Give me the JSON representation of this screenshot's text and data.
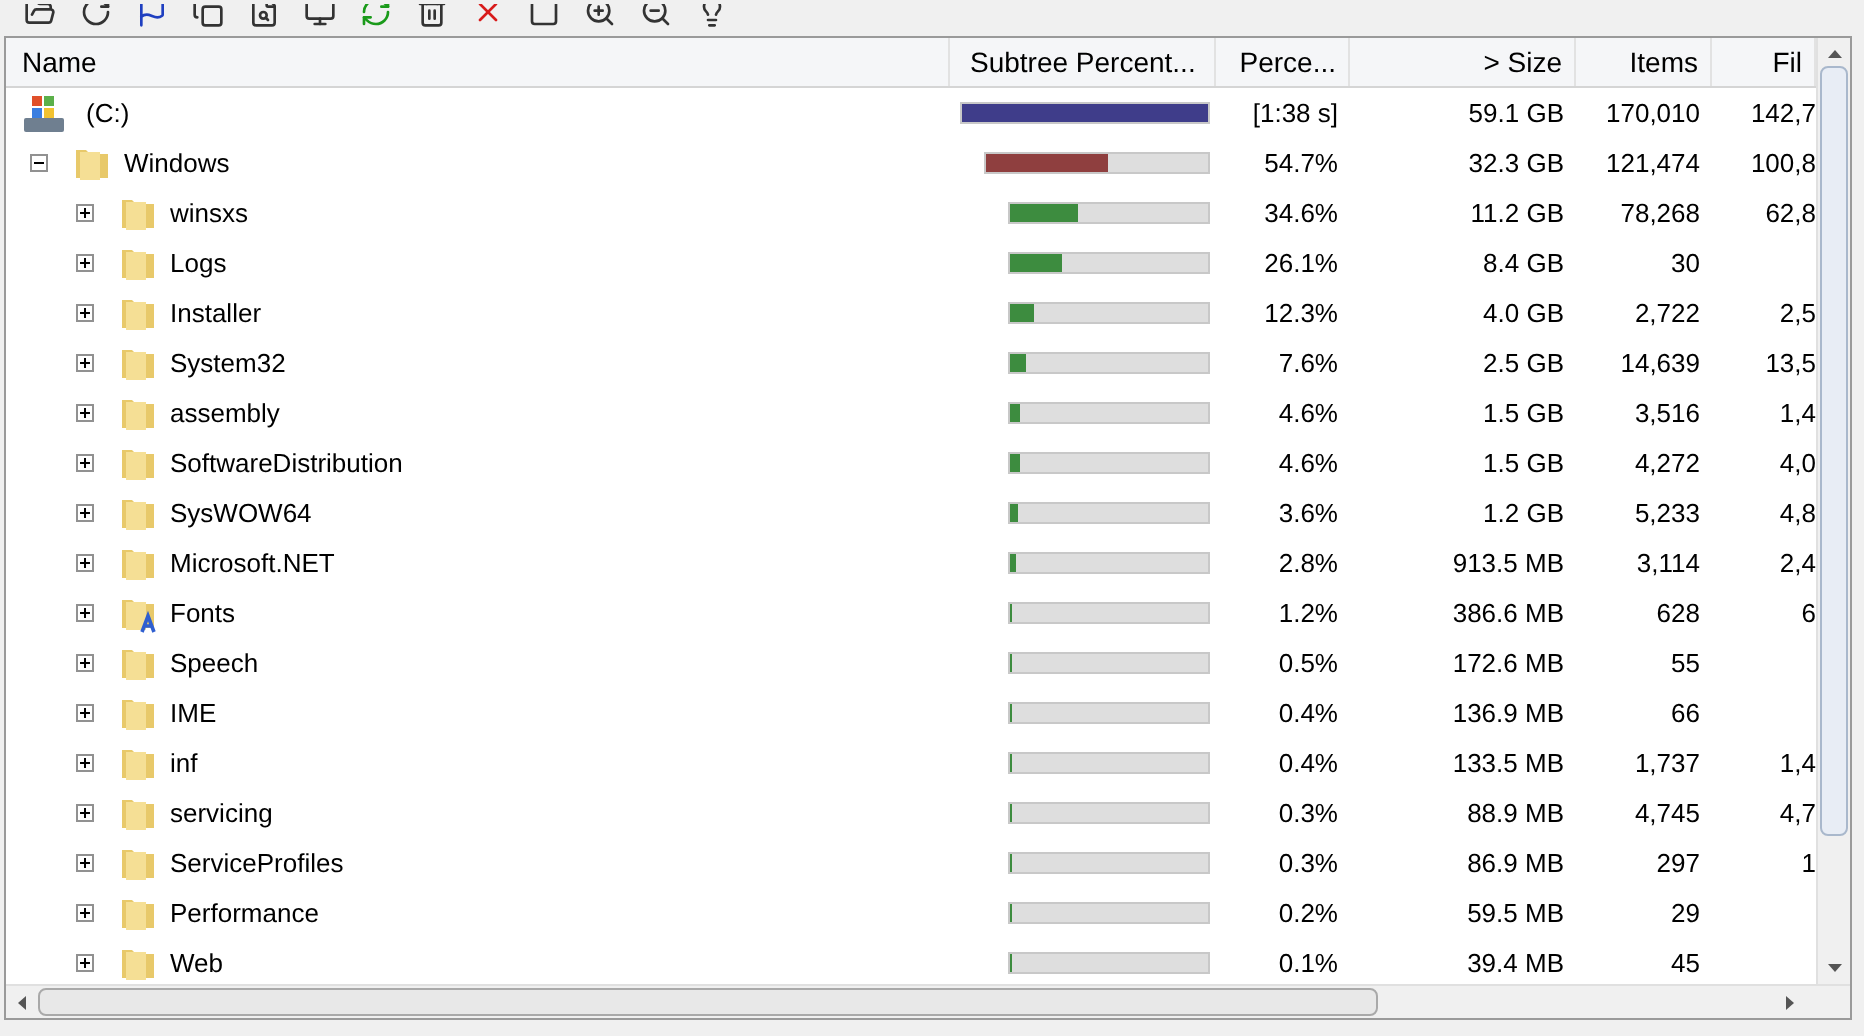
{
  "columns": [
    {
      "label": "Name"
    },
    {
      "label": "Subtree Percent..."
    },
    {
      "label": "Perce..."
    },
    {
      "label": "> Size"
    },
    {
      "label": "Items"
    },
    {
      "label": "Fil"
    }
  ],
  "tree": [
    {
      "name": "(C:)",
      "kind": "drive",
      "level": 1,
      "percent": "[1:38 s]",
      "size": "59.1 GB",
      "items": "170,010",
      "files": "142,7",
      "children": [
        {
          "name": "Windows",
          "kind": "folder",
          "level": 0.547,
          "percent": "54.7%",
          "size": "32.3 GB",
          "items": "121,474",
          "files": "100,8",
          "expanded": true,
          "children": [
            {
              "name": "winsxs",
              "kind": "folder",
              "level": 0.346,
              "percent": "34.6%",
              "size": "11.2 GB",
              "items": "78,268",
              "files": "62,8",
              "expanded": false
            },
            {
              "name": "Logs",
              "kind": "folder",
              "level": 0.261,
              "percent": "26.1%",
              "size": "8.4 GB",
              "items": "30",
              "expanded": false
            },
            {
              "name": "Installer",
              "kind": "folder",
              "level": 0.123,
              "percent": "12.3%",
              "size": "4.0 GB",
              "items": "2,722",
              "files": "2,5",
              "expanded": false
            },
            {
              "name": "System32",
              "kind": "folder",
              "level": 0.076,
              "percent": "7.6%",
              "size": "2.5 GB",
              "items": "14,639",
              "files": "13,5",
              "expanded": false
            },
            {
              "name": "assembly",
              "kind": "folder",
              "level": 0.046,
              "percent": "4.6%",
              "size": "1.5 GB",
              "items": "3,516",
              "files": "1,4",
              "expanded": false
            },
            {
              "name": "SoftwareDistribution",
              "kind": "folder",
              "level": 0.046,
              "percent": "4.6%",
              "size": "1.5 GB",
              "items": "4,272",
              "files": "4,0",
              "expanded": false
            },
            {
              "name": "SysWOW64",
              "kind": "folder",
              "level": 0.036,
              "percent": "3.6%",
              "size": "1.2 GB",
              "items": "5,233",
              "files": "4,8",
              "expanded": false
            },
            {
              "name": "Microsoft.NET",
              "kind": "folder",
              "level": 0.028,
              "percent": "2.8%",
              "size": "913.5 MB",
              "items": "3,114",
              "files": "2,4",
              "expanded": false
            },
            {
              "name": "Fonts",
              "kind": "fonts",
              "level": 0.012,
              "percent": "1.2%",
              "size": "386.6 MB",
              "items": "628",
              "files": "6",
              "expanded": false
            },
            {
              "name": "Speech",
              "kind": "folder",
              "level": 0.005,
              "percent": "0.5%",
              "size": "172.6 MB",
              "items": "55",
              "expanded": false
            },
            {
              "name": "IME",
              "kind": "folder",
              "level": 0.004,
              "percent": "0.4%",
              "size": "136.9 MB",
              "items": "66",
              "expanded": false
            },
            {
              "name": "inf",
              "kind": "folder",
              "level": 0.004,
              "percent": "0.4%",
              "size": "133.5 MB",
              "items": "1,737",
              "files": "1,4",
              "expanded": false
            },
            {
              "name": "servicing",
              "kind": "folder",
              "level": 0.003,
              "percent": "0.3%",
              "size": "88.9 MB",
              "items": "4,745",
              "files": "4,7",
              "expanded": false
            },
            {
              "name": "ServiceProfiles",
              "kind": "folder",
              "level": 0.003,
              "percent": "0.3%",
              "size": "86.9 MB",
              "items": "297",
              "files": "1",
              "expanded": false
            },
            {
              "name": "Performance",
              "kind": "folder",
              "level": 0.002,
              "percent": "0.2%",
              "size": "59.5 MB",
              "items": "29",
              "expanded": false
            },
            {
              "name": "Web",
              "kind": "folder",
              "level": 0.001,
              "percent": "0.1%",
              "size": "39.4 MB",
              "items": "45",
              "expanded": false
            }
          ]
        }
      ]
    }
  ]
}
